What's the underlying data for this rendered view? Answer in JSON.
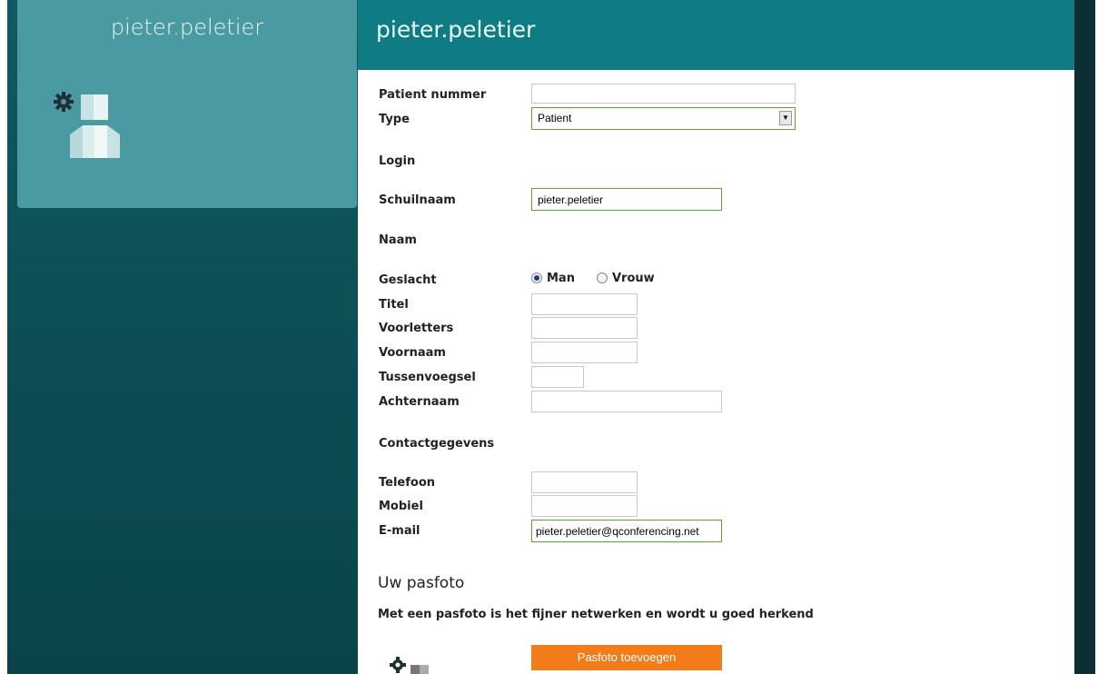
{
  "card": {
    "title": "pieter.peletier"
  },
  "panel": {
    "title": "pieter.peletier"
  },
  "form": {
    "patient_nummer": {
      "label": "Patient nummer",
      "value": ""
    },
    "type": {
      "label": "Type",
      "value": "Patient"
    },
    "login_section": "Login",
    "schuilnaam": {
      "label": "Schuilnaam",
      "value": "pieter.peletier"
    },
    "naam_section": "Naam",
    "geslacht": {
      "label": "Geslacht",
      "options": [
        "Man",
        "Vrouw"
      ],
      "selected": "Man"
    },
    "titel": {
      "label": "Titel",
      "value": ""
    },
    "voorletters": {
      "label": "Voorletters",
      "value": ""
    },
    "voornaam": {
      "label": "Voornaam",
      "value": ""
    },
    "tussenvoegsel": {
      "label": "Tussenvoegsel",
      "value": ""
    },
    "achternaam": {
      "label": "Achternaam",
      "value": ""
    },
    "contact_section": "Contactgegevens",
    "telefoon": {
      "label": "Telefoon",
      "value": ""
    },
    "mobiel": {
      "label": "Mobiel",
      "value": ""
    },
    "email": {
      "label": "E-mail",
      "value": "pieter.peletier@qconferencing.net"
    }
  },
  "photo": {
    "heading": "Uw pasfoto",
    "text": "Met een pasfoto is het fijner netwerken en wordt u goed herkend",
    "button_label": "Pasfoto toevoegen"
  },
  "icons": {
    "avatar": "avatar-with-gear-icon"
  },
  "colors": {
    "accent": "#0f7c84",
    "card": "#4a9ba1",
    "button": "#f27b1a",
    "focus_border": "#62a23a"
  }
}
